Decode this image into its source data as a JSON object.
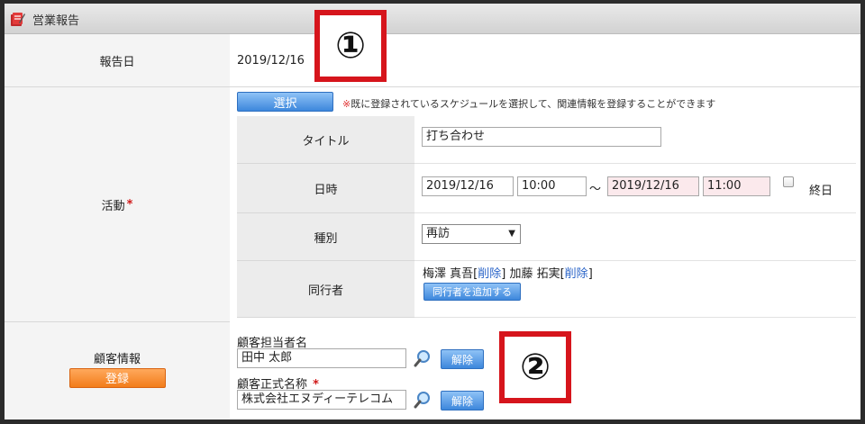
{
  "header": {
    "title": "営業報告"
  },
  "report_date": {
    "label": "報告日",
    "value": "2019/12/16"
  },
  "activity": {
    "label": "活動",
    "required_mark": "*",
    "select_button": "選択",
    "note_mark": "※",
    "note_text": "既に登録されているスケジュールを選択して、関連情報を登録することができます",
    "title_label": "タイトル",
    "title_value": "打ち合わせ",
    "datetime_label": "日時",
    "start_date": "2019/12/16",
    "start_time": "10:00",
    "range_sep": "～",
    "end_date": "2019/12/16",
    "end_time": "11:00",
    "allday_label": "終日",
    "type_label": "種別",
    "type_value": "再訪",
    "companions_label": "同行者",
    "companions": [
      {
        "name": "梅澤 真吾",
        "delete_label": "削除"
      },
      {
        "name": "加藤 拓実",
        "delete_label": "削除"
      }
    ],
    "add_companion_button": "同行者を追加する"
  },
  "customer": {
    "label": "顧客情報",
    "register_button": "登録",
    "contact_label": "顧客担当者名",
    "contact_value": "田中 太郎",
    "company_label": "顧客正式名称",
    "company_required_mark": "*",
    "company_value": "株式会社エヌディーテレコム",
    "release_button": "解除"
  },
  "callouts": {
    "one": "①",
    "two": "②"
  }
}
